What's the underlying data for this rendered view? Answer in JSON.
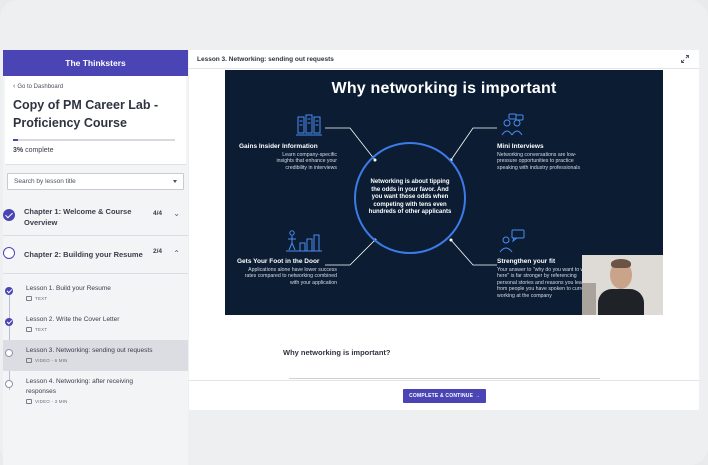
{
  "sidebar": {
    "brand": "The Thinksters",
    "back_link": "Go to Dashboard",
    "course_title": "Copy of PM Career Lab - Proficiency Course",
    "progress_percent_label": "3%",
    "progress_suffix": "complete",
    "progress_value": 0.03,
    "search_placeholder": "Search by lesson title",
    "chapters": [
      {
        "title": "Chapter 1: Welcome & Course Overview",
        "count": "4/4",
        "status": "complete",
        "expanded": false
      },
      {
        "title": "Chapter 2: Building your Resume",
        "count": "2/4",
        "status": "in-progress",
        "expanded": true
      }
    ],
    "lessons": [
      {
        "title": "Lesson 1. Build your Resume",
        "meta": "TEXT",
        "status": "complete"
      },
      {
        "title": "Lesson 2. Write the Cover Letter",
        "meta": "TEXT",
        "status": "complete"
      },
      {
        "title": "Lesson 3. Networking: sending out requests",
        "meta": "VIDEO - 6 MIN",
        "status": "current"
      },
      {
        "title": "Lesson 4. Networking: after receiving responses",
        "meta": "VIDEO - 3 MIN",
        "status": "open"
      }
    ]
  },
  "main": {
    "header_title": "Lesson 3. Networking: sending out requests",
    "slide": {
      "title": "Why networking is important",
      "center_text": "Networking is about tipping the odds in your favor. And you want those odds when competing with tens even hundreds of other applicants",
      "blocks": [
        {
          "heading": "Gains Insider Information",
          "text": "Learn company-specific insights that enhance your credibility in interviews"
        },
        {
          "heading": "Mini Interviews",
          "text": "Networking conversations are low-pressure opportunities to practice speaking with industry professionals"
        },
        {
          "heading": "Gets Your Foot in the Door",
          "text": "Applications alone have lower success rates compared to networking combined with your application"
        },
        {
          "heading": "Strengthen your fit",
          "text": "Your answer to \"why do you want to work here\" is far stronger by referencing personal stories and reasons you learned from people you have spoken to currently working at the company"
        }
      ]
    },
    "question": "Why networking is important?",
    "continue_label": "COMPLETE & CONTINUE →"
  },
  "colors": {
    "brand": "#4a44b5",
    "slide_bg": "#0b1c33",
    "circle": "#3d7be6"
  }
}
